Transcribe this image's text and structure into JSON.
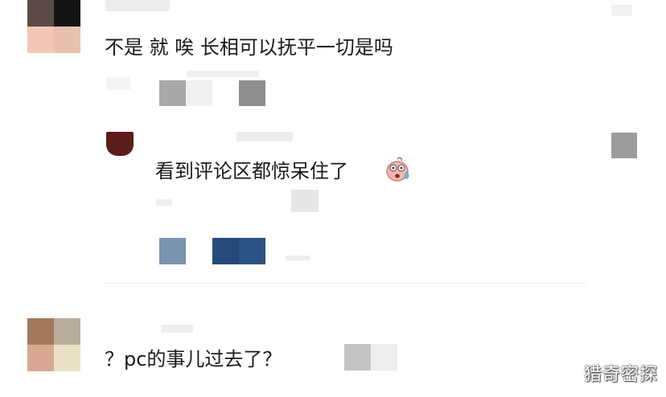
{
  "comments": [
    {
      "text": "不是 就 唉 长相可以抚平一切是吗"
    },
    {
      "text": "看到评论区都惊呆住了"
    },
    {
      "text": "？pc的事儿过去了？"
    }
  ],
  "emoji": {
    "name": "shocked-sweat-emoji"
  },
  "watermark": {
    "text": "猎奇密探"
  }
}
